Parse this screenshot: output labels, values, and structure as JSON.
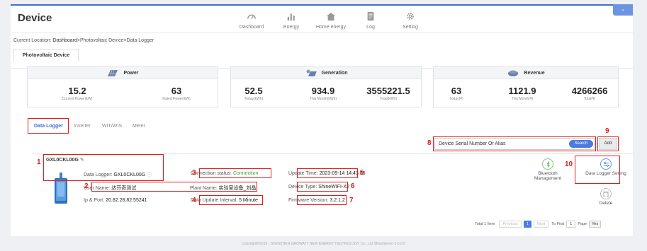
{
  "app": {
    "title": "Device",
    "corner_button": ""
  },
  "nav": [
    {
      "label": "Dashboard",
      "icon": "speedometer-icon"
    },
    {
      "label": "Energy",
      "icon": "bar-chart-icon"
    },
    {
      "label": "Home energy",
      "icon": "home-icon"
    },
    {
      "label": "Log",
      "icon": "document-icon"
    },
    {
      "label": "Setting",
      "icon": "gear-icon"
    }
  ],
  "breadcrumb": {
    "prefix": "Current Location: ",
    "home": "Dashboard",
    "rest": ">Photovoltaic Device>Data Logger"
  },
  "pv_tab": "Photovoltaic Device",
  "stats": {
    "power": {
      "title": "Power",
      "items": [
        {
          "value": "15.2",
          "label": "Current Power(kW)"
        },
        {
          "value": "63",
          "label": "Rated Power(kW)"
        }
      ]
    },
    "generation": {
      "title": "Generation",
      "items": [
        {
          "value": "52.5",
          "label": "Today(kWh)"
        },
        {
          "value": "934.9",
          "label": "This Month(kWh)"
        },
        {
          "value": "3555221.5",
          "label": "Total(kWh)"
        }
      ]
    },
    "revenue": {
      "title": "Revenue",
      "items": [
        {
          "value": "63",
          "label": "Today(¥)"
        },
        {
          "value": "1121.9",
          "label": "This Month(¥)"
        },
        {
          "value": "4266266",
          "label": "Total(¥)"
        }
      ]
    }
  },
  "subtabs": [
    "Data Logger",
    "Inverter",
    "WIT/WIS",
    "Meter"
  ],
  "search": {
    "placeholder": "Device Serial Number Or Alias",
    "button": "Search",
    "add": "Add"
  },
  "logger": {
    "serial": "GXL0CKL00G",
    "data_logger_label": "Data Logger: ",
    "data_logger_value": "GXL0CKL00G",
    "user_label": "User Name: ",
    "user_value": "达芬奇测试",
    "plant_label": "Plant Name: ",
    "plant_value": "实验室设备_刘晶",
    "ip_label": "Ip & Port: ",
    "ip_value": "20.82.28.82:55241",
    "conn_label": "Connection status: ",
    "conn_value": "Connection",
    "interval_label": "Data Update Interval: ",
    "interval_value": "5 Minute",
    "update_label": "Update Time: ",
    "update_value": "2023-09-14 14:43:55",
    "type_label": "Device Type: ",
    "type_value": "ShineWIFI-X2",
    "fw_label": "Firmware Version: ",
    "fw_value": "3.2.1.2",
    "bt_label": "Bluetooth Management",
    "setting_label": "Data Logger Setting",
    "delete_label": "Delete"
  },
  "markers": [
    "1",
    "2",
    "3",
    "4",
    "5",
    "6",
    "7",
    "8",
    "9",
    "10"
  ],
  "pager": {
    "total": "Total 1 Item",
    "prev": "Previous",
    "page": "1",
    "next": "Next",
    "to_first": "To First",
    "input": "1",
    "page_label": "Page",
    "go": "Yes"
  },
  "footer": "Copyright©2019 - SHENZHEN GROWATT NEW ENERGY TECHNOLOGY Co., Ltd ShineServer-3.6.0.0",
  "colors": {
    "accent": "#3b6fd1",
    "highlight": "#e21b1b",
    "connected": "#3aa33a"
  }
}
